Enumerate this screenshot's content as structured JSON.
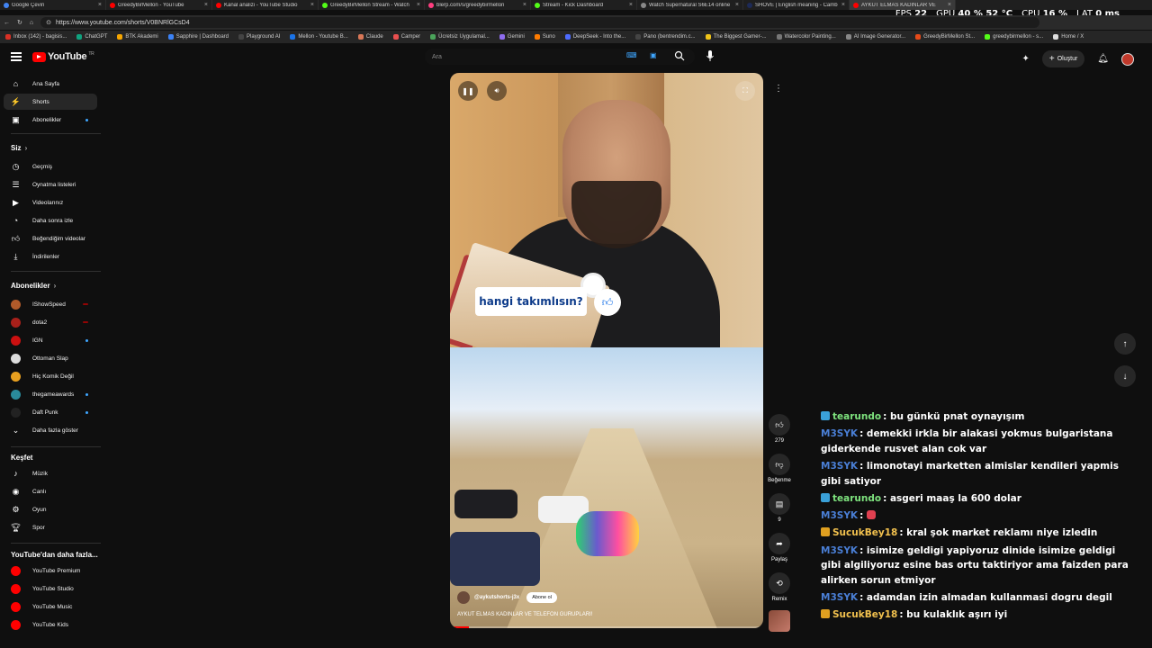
{
  "browser": {
    "tabs": [
      {
        "title": "Google Çeviri",
        "color": "#4285f4"
      },
      {
        "title": "GreedyBirMellon - YouTube",
        "color": "#ff0000"
      },
      {
        "title": "Kanal analizi - YouTube Studio",
        "color": "#ff0000"
      },
      {
        "title": "GreedyBirMellon Stream - Watch",
        "color": "#53fc18"
      },
      {
        "title": "blerp.com/s/greedybirmellon",
        "color": "#ff3e7f"
      },
      {
        "title": "Stream - Kick Dashboard",
        "color": "#53fc18"
      },
      {
        "title": "Watch Supernatural S6E14 online",
        "color": "#888888"
      },
      {
        "title": "SHOVE | English meaning - Camb",
        "color": "#1d2a57"
      },
      {
        "title": "AYKUT ELMAS KADINLAR VE",
        "color": "#ff0000"
      }
    ],
    "url": "https://www.youtube.com/shorts/V0BNRlGCsD4",
    "bookmarks": [
      "Inbox (142) - bagisis...",
      "ChatGPT",
      "BTK Akademi",
      "Sapphire | Dashboard",
      "Playground AI",
      "Mellon - Youtube B...",
      "Claude",
      "Camper",
      "Ücretsiz Uygulamal...",
      "Gemini",
      "Suno",
      "DeepSeek - Into the...",
      "Pano (bentrendim.c...",
      "The Biggest Gamer-...",
      "Watercolor Painting...",
      "AI Image Generator...",
      "GreedyBirMellon St...",
      "greedybirmellon - s...",
      "Home / X"
    ]
  },
  "overlay": {
    "fps_label": "FPS",
    "fps_value": "22",
    "gpu_label": "GPU",
    "gpu_value": "40 % 52 °C",
    "cpu_label": "CPU",
    "cpu_value": "16 %",
    "lat_label": "LAT",
    "lat_value": "0 ms"
  },
  "header": {
    "logo_text": "YouTube",
    "logo_country": "TR",
    "search_placeholder": "Ara",
    "create_label": "Oluştur"
  },
  "sidebar": {
    "main": [
      {
        "label": "Ana Sayfa",
        "icon": "home-icon"
      },
      {
        "label": "Shorts",
        "icon": "shorts-icon"
      },
      {
        "label": "Abonelikler",
        "icon": "subscriptions-icon"
      }
    ],
    "you_header": "Siz",
    "you": [
      {
        "label": "Geçmiş",
        "icon": "history-icon"
      },
      {
        "label": "Oynatma listeleri",
        "icon": "playlist-icon"
      },
      {
        "label": "Videolarınız",
        "icon": "your-videos-icon"
      },
      {
        "label": "Daha sonra izle",
        "icon": "watch-later-icon"
      },
      {
        "label": "Beğendiğim videolar",
        "icon": "liked-videos-icon"
      },
      {
        "label": "İndirilenler",
        "icon": "downloads-icon"
      }
    ],
    "subs_header": "Abonelikler",
    "subs": [
      {
        "label": "IShowSpeed",
        "color": "#b05a2a",
        "status": "live"
      },
      {
        "label": "dota2",
        "color": "#a8201a",
        "status": "live"
      },
      {
        "label": "IGN",
        "color": "#cc1010",
        "status": "new"
      },
      {
        "label": "Ottoman Slap",
        "color": "#dddddd",
        "status": ""
      },
      {
        "label": "Hiç Komik Değil",
        "color": "#e8a020",
        "status": ""
      },
      {
        "label": "thegameawards",
        "color": "#2a8a9a",
        "status": "new"
      },
      {
        "label": "Daft Punk",
        "color": "#222222",
        "status": "new"
      }
    ],
    "show_more": "Daha fazla göster",
    "explore_header": "Keşfet",
    "explore": [
      {
        "label": "Müzik",
        "icon": "music-icon"
      },
      {
        "label": "Canlı",
        "icon": "live-icon"
      },
      {
        "label": "Oyun",
        "icon": "gaming-icon"
      },
      {
        "label": "Spor",
        "icon": "sports-icon"
      }
    ],
    "more_header": "YouTube'dan daha fazla...",
    "more": [
      {
        "label": "YouTube Premium"
      },
      {
        "label": "YouTube Studio"
      },
      {
        "label": "YouTube Music"
      },
      {
        "label": "YouTube Kids"
      }
    ]
  },
  "video": {
    "sticker_text": "hangi takımlısın?",
    "channel": "@aykutshorts-j3x",
    "subscribe_label": "Abone ol",
    "title": "AYKUT ELMAS KADINLAR VE TELEFON GURUPLARI!",
    "progress": 0.06
  },
  "actions": {
    "like_count": "279",
    "dislike_label": "Beğenme",
    "comment_count": "9",
    "share_label": "Paylaş",
    "remix_label": "Remix"
  },
  "chat": [
    {
      "user": "tearundo",
      "color": "#7ee37e",
      "badge": "#3aa0d8",
      "text": "bu günkü pnat oynayışım"
    },
    {
      "user": "M3SYK",
      "color": "#4a7fd6",
      "badge": "",
      "text": "demekki irkla bir alakasi yokmus bulgaristana giderkende rusvet alan cok var"
    },
    {
      "user": "M3SYK",
      "color": "#4a7fd6",
      "badge": "",
      "text": "limonotayi marketten almislar kendileri yapmis gibi satiyor"
    },
    {
      "user": "tearundo",
      "color": "#7ee37e",
      "badge": "#3aa0d8",
      "text": "asgeri maaş la 600 dolar"
    },
    {
      "user": "M3SYK",
      "color": "#4a7fd6",
      "badge": "",
      "text": "",
      "emote": true
    },
    {
      "user": "SucukBey18",
      "color": "#f2c14e",
      "badge": "#e0a020",
      "text": "kral şok market reklamı niye izledin"
    },
    {
      "user": "M3SYK",
      "color": "#4a7fd6",
      "badge": "",
      "text": "isimize geldigi yapiyoruz dinide isimize geldigi gibi algiliyoruz esine bas ortu taktiriyor ama faizden para alirken sorun etmiyor"
    },
    {
      "user": "M3SYK",
      "color": "#4a7fd6",
      "badge": "",
      "text": "adamdan izin almadan kullanmasi dogru degil"
    },
    {
      "user": "SucukBey18",
      "color": "#f2c14e",
      "badge": "#e0a020",
      "text": "bu kulaklık aşırı iyi"
    }
  ]
}
